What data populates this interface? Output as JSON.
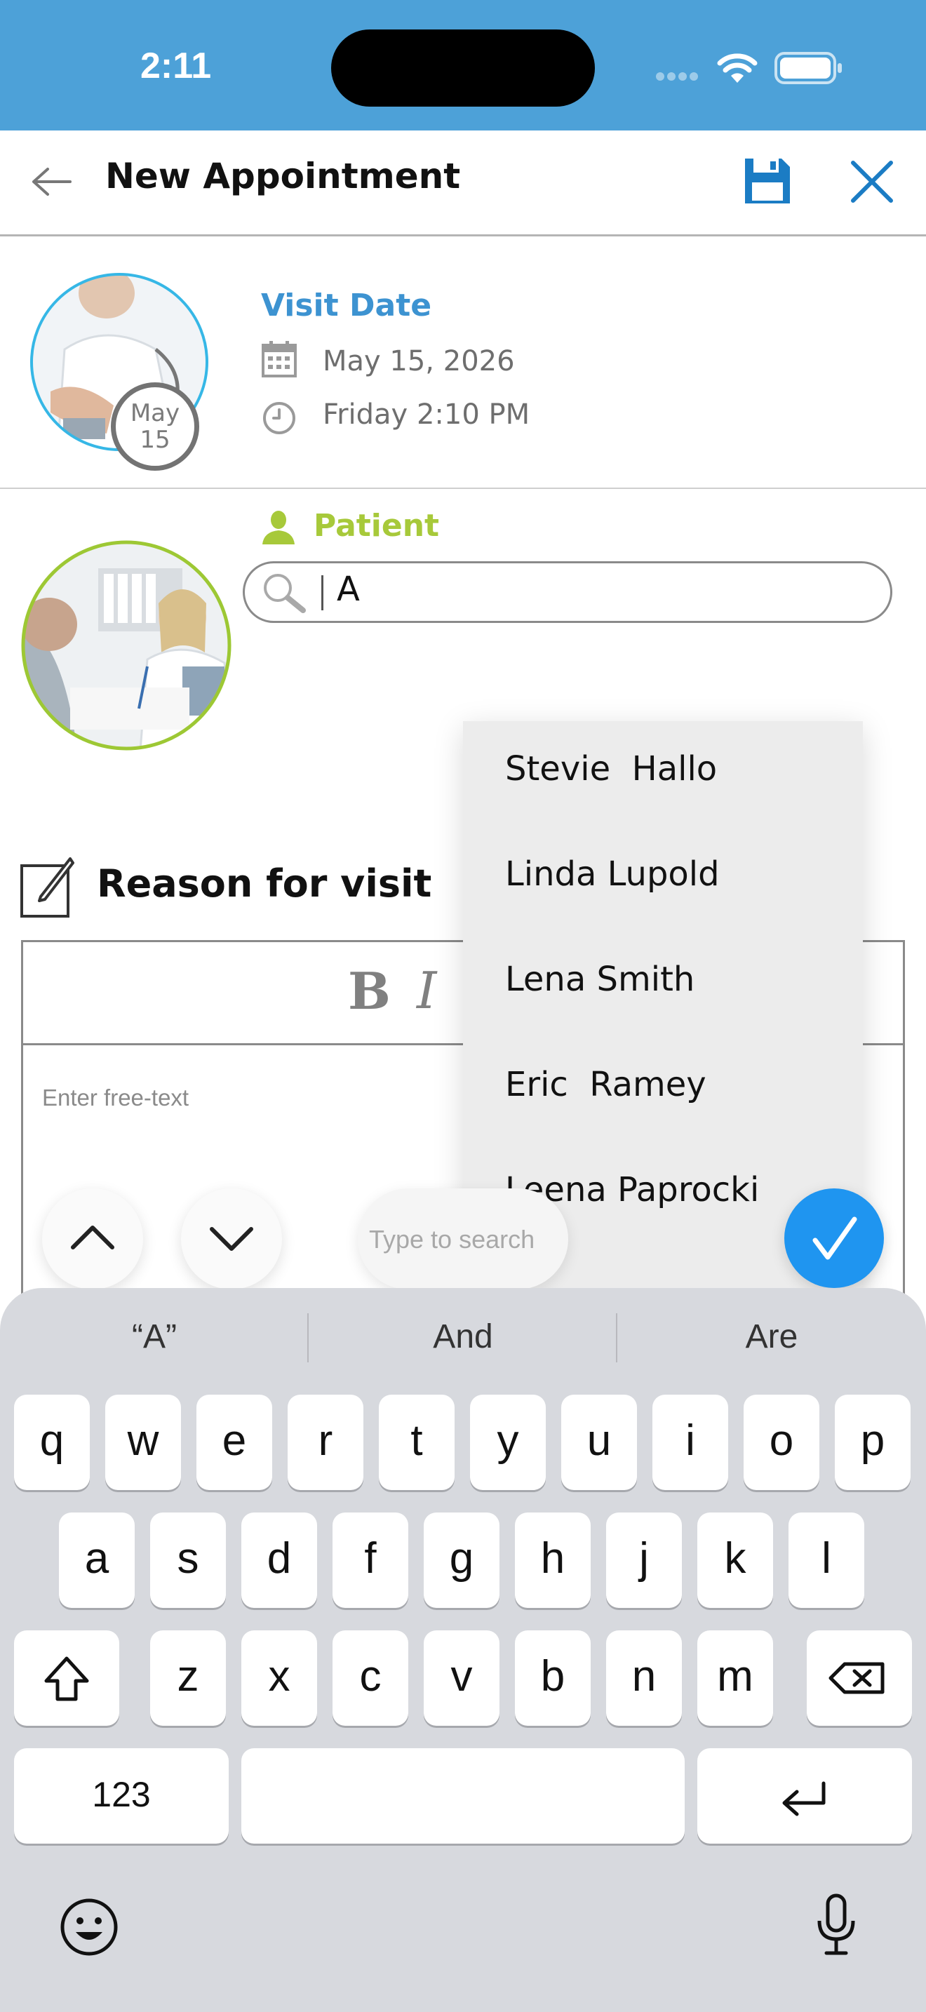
{
  "status_bar": {
    "time": "2:11"
  },
  "header": {
    "title": "New Appointment"
  },
  "visit": {
    "label": "Visit Date",
    "date": "May 15, 2026",
    "time": "Friday 2:10 PM",
    "badge_month": "May",
    "badge_day": "15"
  },
  "patient": {
    "label": "Patient",
    "search_value": "A"
  },
  "dropdown": {
    "items": [
      "Stevie  Hallo",
      "Linda Lupold",
      "Lena Smith",
      "Eric  Ramey",
      "Leena Paprocki"
    ]
  },
  "reason": {
    "title": "Reason for visit",
    "bold": "B",
    "italic": "I",
    "placeholder": "Enter free-text"
  },
  "accessory": {
    "search_placeholder": "Type to search"
  },
  "keyboard": {
    "suggestions": [
      "“A”",
      "And",
      "Are"
    ],
    "row1": [
      "q",
      "w",
      "e",
      "r",
      "t",
      "y",
      "u",
      "i",
      "o",
      "p"
    ],
    "row2": [
      "a",
      "s",
      "d",
      "f",
      "g",
      "h",
      "j",
      "k",
      "l"
    ],
    "row3": [
      "z",
      "x",
      "c",
      "v",
      "b",
      "n",
      "m"
    ],
    "numbers_label": "123"
  },
  "colors": {
    "status_bar": "#4da1d8",
    "accent_blue": "#3d93d1",
    "patient_green": "#a7c93a",
    "done_blue": "#1f95f0"
  }
}
